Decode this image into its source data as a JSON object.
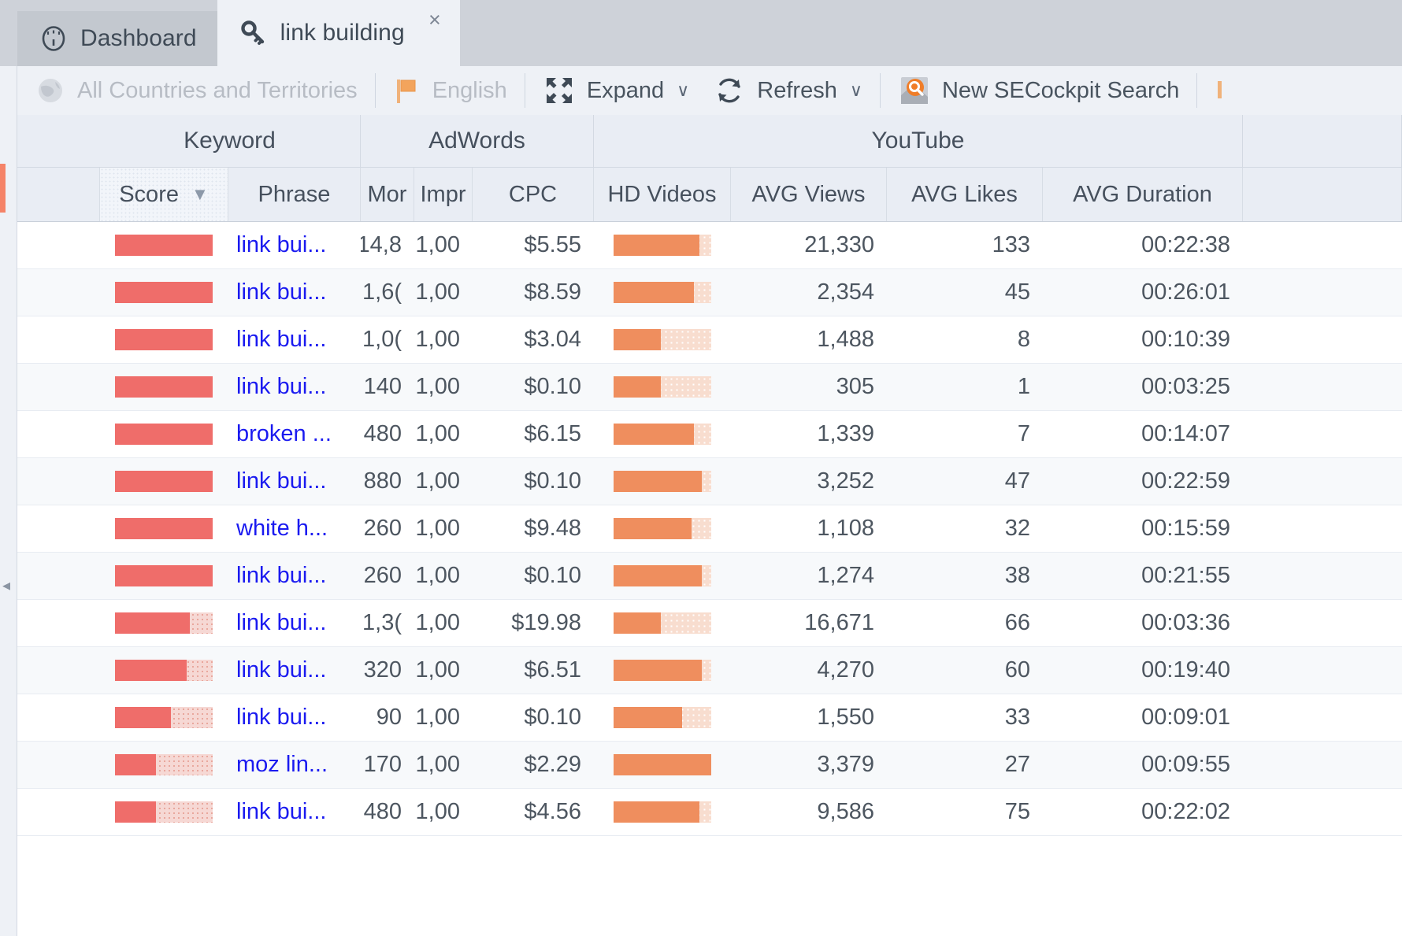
{
  "tabs": [
    {
      "label": "Dashboard",
      "icon": "gauge-icon",
      "active": false,
      "closable": false
    },
    {
      "label": "link building",
      "icon": "key-icon",
      "active": true,
      "closable": true,
      "close_glyph": "×"
    }
  ],
  "toolbar": {
    "country_filter": {
      "label": "All Countries and Territories",
      "icon": "globe-icon",
      "disabled": true
    },
    "language_filter": {
      "label": "English",
      "icon": "flag-icon",
      "disabled": true
    },
    "expand": {
      "label": "Expand",
      "icon": "expand-icon",
      "caret": "∨"
    },
    "refresh": {
      "label": "Refresh",
      "icon": "refresh-icon",
      "caret": "∨"
    },
    "new_search": {
      "label": "New SECockpit Search",
      "icon": "secockpit-logo-icon"
    }
  },
  "colors": {
    "accent_orange": "#f58368",
    "score_bar": "#ef6d6a",
    "score_track": "#f6d8d4",
    "hd_bar": "#ef8e5e",
    "hd_track": "#f8ddcf",
    "link": "#1a1af0",
    "tabbar_bg": "#ced2d9",
    "toolbar_bg": "#eef1f6",
    "header_bg": "#e9edf4"
  },
  "table": {
    "groups": [
      {
        "label": "Keyword",
        "span": 3
      },
      {
        "label": "AdWords",
        "span": 3
      },
      {
        "label": "YouTube",
        "span": 4
      }
    ],
    "columns": [
      {
        "key": "idx",
        "label": "",
        "sorted": false
      },
      {
        "key": "score",
        "label": "Score",
        "sorted": true,
        "sort_dir": "desc",
        "sort_glyph": "▼"
      },
      {
        "key": "phrase",
        "label": "Phrase",
        "sorted": false
      },
      {
        "key": "mon",
        "label": "Mor",
        "sorted": false
      },
      {
        "key": "imp",
        "label": "Impr",
        "sorted": false
      },
      {
        "key": "cpc",
        "label": "CPC",
        "sorted": false
      },
      {
        "key": "hd",
        "label": "HD Videos",
        "sorted": false
      },
      {
        "key": "views",
        "label": "AVG Views",
        "sorted": false
      },
      {
        "key": "likes",
        "label": "AVG Likes",
        "sorted": false
      },
      {
        "key": "dur",
        "label": "AVG Duration",
        "sorted": false
      }
    ],
    "rows": [
      {
        "score_pct": 100,
        "phrase": "link bui...",
        "mon": "14,8",
        "imp": "1,00",
        "cpc": "$5.55",
        "hd_pct": 88,
        "views": "21,330",
        "likes": "133",
        "dur": "00:22:38"
      },
      {
        "score_pct": 100,
        "phrase": "link bui...",
        "mon": "1,6(",
        "imp": "1,00",
        "cpc": "$8.59",
        "hd_pct": 82,
        "views": "2,354",
        "likes": "45",
        "dur": "00:26:01"
      },
      {
        "score_pct": 100,
        "phrase": "link bui...",
        "mon": "1,0(",
        "imp": "1,00",
        "cpc": "$3.04",
        "hd_pct": 48,
        "views": "1,488",
        "likes": "8",
        "dur": "00:10:39"
      },
      {
        "score_pct": 100,
        "phrase": "link bui...",
        "mon": "140",
        "imp": "1,00",
        "cpc": "$0.10",
        "hd_pct": 48,
        "views": "305",
        "likes": "1",
        "dur": "00:03:25"
      },
      {
        "score_pct": 100,
        "phrase": "broken ...",
        "mon": "480",
        "imp": "1,00",
        "cpc": "$6.15",
        "hd_pct": 82,
        "views": "1,339",
        "likes": "7",
        "dur": "00:14:07"
      },
      {
        "score_pct": 100,
        "phrase": "link bui...",
        "mon": "880",
        "imp": "1,00",
        "cpc": "$0.10",
        "hd_pct": 90,
        "views": "3,252",
        "likes": "47",
        "dur": "00:22:59"
      },
      {
        "score_pct": 100,
        "phrase": "white h...",
        "mon": "260",
        "imp": "1,00",
        "cpc": "$9.48",
        "hd_pct": 80,
        "views": "1,108",
        "likes": "32",
        "dur": "00:15:59"
      },
      {
        "score_pct": 100,
        "phrase": "link bui...",
        "mon": "260",
        "imp": "1,00",
        "cpc": "$0.10",
        "hd_pct": 90,
        "views": "1,274",
        "likes": "38",
        "dur": "00:21:55"
      },
      {
        "score_pct": 77,
        "phrase": "link bui...",
        "mon": "1,3(",
        "imp": "1,00",
        "cpc": "$19.98",
        "hd_pct": 48,
        "views": "16,671",
        "likes": "66",
        "dur": "00:03:36"
      },
      {
        "score_pct": 73,
        "phrase": "link bui...",
        "mon": "320",
        "imp": "1,00",
        "cpc": "$6.51",
        "hd_pct": 90,
        "views": "4,270",
        "likes": "60",
        "dur": "00:19:40"
      },
      {
        "score_pct": 57,
        "phrase": "link bui...",
        "mon": "90",
        "imp": "1,00",
        "cpc": "$0.10",
        "hd_pct": 70,
        "views": "1,550",
        "likes": "33",
        "dur": "00:09:01"
      },
      {
        "score_pct": 42,
        "phrase": "moz lin...",
        "mon": "170",
        "imp": "1,00",
        "cpc": "$2.29",
        "hd_pct": 100,
        "views": "3,379",
        "likes": "27",
        "dur": "00:09:55"
      },
      {
        "score_pct": 42,
        "phrase": "link bui...",
        "mon": "480",
        "imp": "1,00",
        "cpc": "$4.56",
        "hd_pct": 88,
        "views": "9,586",
        "likes": "75",
        "dur": "00:22:02"
      }
    ]
  }
}
